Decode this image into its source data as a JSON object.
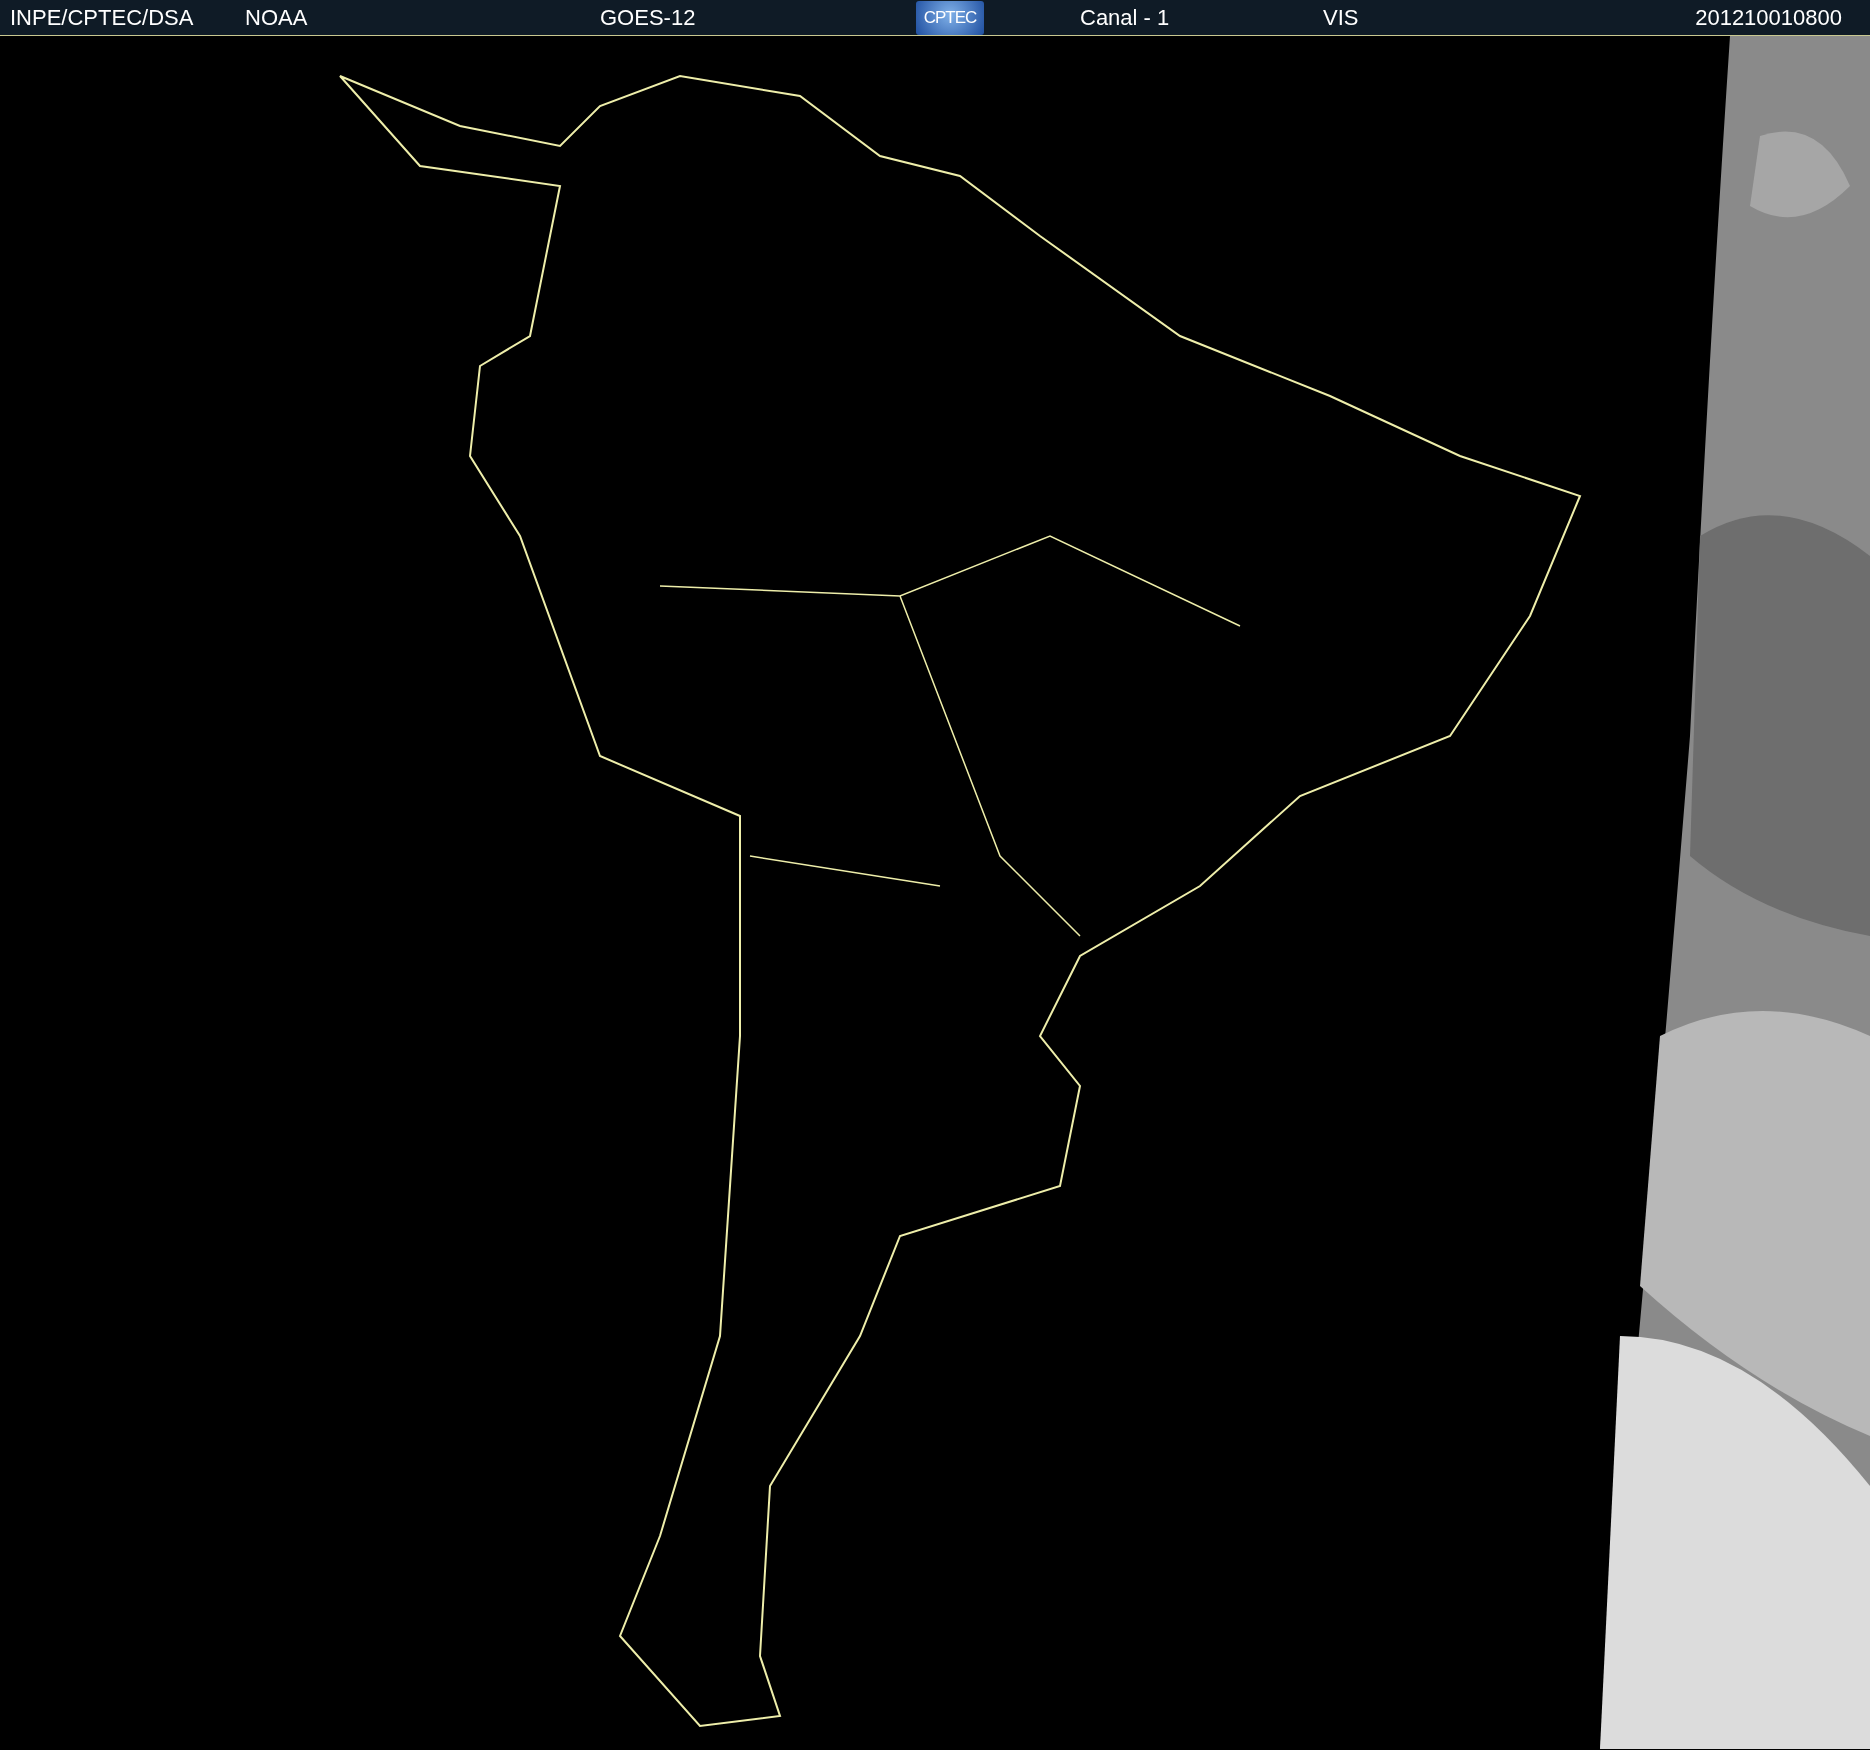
{
  "header": {
    "labels": [
      "INPE/CPTEC/DSA",
      "NOAA",
      "GOES-12"
    ],
    "logo": "CPTEC",
    "channel": "Canal - 1",
    "band": "VIS",
    "timestamp": "201210010800"
  }
}
